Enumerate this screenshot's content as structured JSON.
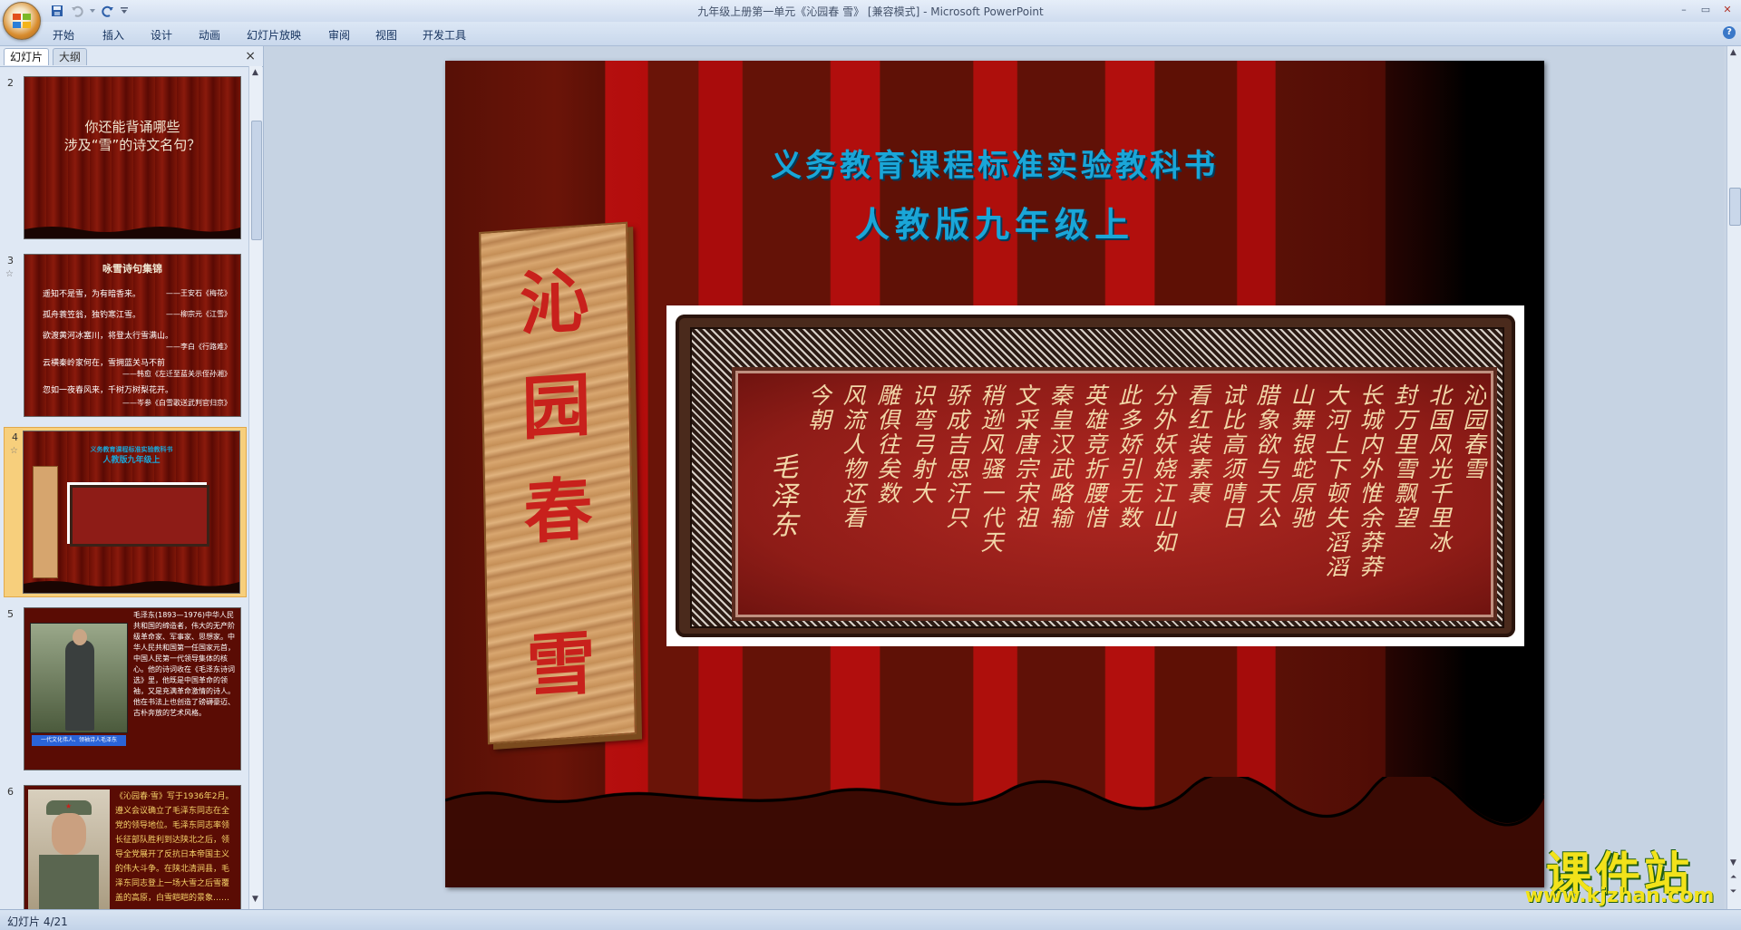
{
  "window": {
    "title": "九年级上册第一单元《沁园春 雪》 [兼容模式] - Microsoft PowerPoint"
  },
  "ribbon": {
    "tabs": [
      "开始",
      "插入",
      "设计",
      "动画",
      "幻灯片放映",
      "审阅",
      "视图",
      "开发工具"
    ]
  },
  "left_pane": {
    "tabs": [
      "幻灯片",
      "大纲"
    ],
    "close": "×",
    "thumbnails": [
      {
        "num": "2",
        "lines": [
          "你还能背诵哪些",
          "涉及“雪”的诗文名句？"
        ]
      },
      {
        "num": "3",
        "title": "咏雪诗句集锦",
        "poems": [
          {
            "text": "遥知不是雪，为有暗香来。",
            "src": "——王安石《梅花》"
          },
          {
            "text": "孤舟蓑笠翁，独钓寒江雪。",
            "src": "——柳宗元《江雪》"
          },
          {
            "text": "欲渡黄河冰塞川，将登太行雪满山。",
            "src": "——李白《行路难》"
          },
          {
            "text": "云横秦岭家何在，雪拥蓝关马不前",
            "src": "——韩愈《左迁至蓝关示侄孙湘》"
          },
          {
            "text": "忽如一夜春风来，千树万树梨花开。",
            "src": "——岑参《白雪歌送武判官归京》"
          }
        ]
      },
      {
        "num": "4",
        "line1": "义务教育课程标准实验教科书",
        "line2": "人教版九年级上"
      },
      {
        "num": "5",
        "text": "毛泽东(1893—1976)中华人民共和国的缔造者，伟大的无产阶级革命家、军事家、思想家。中华人民共和国第一任国家元首，中国人民第一代领导集体的核心。他的诗词收在《毛泽东诗词选》里，他既是中国革命的领袖，又是充满革命激情的诗人。他在书法上也创造了磅礴豪迈、古朴奔放的艺术风格。",
        "caption": "一代文化伟人、领袖诗人毛泽东"
      },
      {
        "num": "6",
        "text": "《沁园春·雪》写于1936年2月。遵义会议确立了毛泽东同志在全党的领导地位。毛泽东同志率领长征部队胜利到达陕北之后，领导全党展开了反抗日本帝国主义的伟大斗争。在陕北清涧县，毛泽东同志登上一场大雪之后雪覆盖的高原，白雪皑皑的景象……"
      }
    ]
  },
  "slide": {
    "title1": "义务教育课程标准实验教科书",
    "title2": "人教版九年级上",
    "plaque": [
      "沁",
      "园",
      "春",
      "雪"
    ],
    "calligraphy_columns": [
      "沁园春雪",
      "北国风光千里冰",
      "封万里雪飘望",
      "长城内外惟余莽莽",
      "大河上下顿失滔滔",
      "山舞银蛇原驰",
      "腊象欲与天公",
      "试比高须晴日",
      "看红装素裹",
      "分外妖娆江山如",
      "此多娇引无数",
      "英雄竞折腰惜",
      "秦皇汉武略输",
      "文采唐宗宋祖",
      "稍逊风骚一代天",
      "骄成吉思汗只",
      "识弯弓射大",
      "雕俱往矣数",
      "风流人物还看",
      "今朝",
      "毛泽东"
    ]
  },
  "status": {
    "slide_indicator": "幻灯片 4/21"
  },
  "watermark": {
    "text": "课件站",
    "url": "www.kjzhan.com"
  }
}
